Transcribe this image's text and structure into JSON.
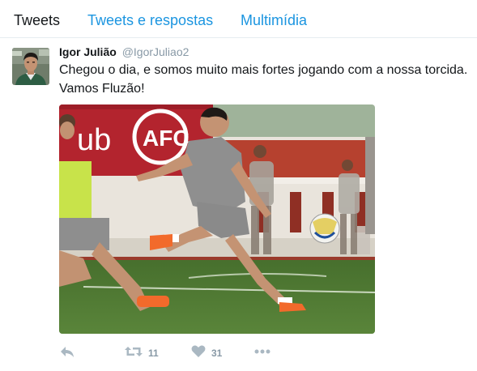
{
  "tabs": [
    {
      "label": "Tweets",
      "active": true
    },
    {
      "label": "Tweets e respostas",
      "active": false
    },
    {
      "label": "Multimídia",
      "active": false
    }
  ],
  "tweet": {
    "fullname": "Igor Julião",
    "username": "@IgorJuliao2",
    "text_line1": "Chegou o dia, e somos muito mais fortes jogando com a nossa torcida.",
    "text_line2": "Vamos Fluzão!",
    "media": {
      "banner_text": "ub",
      "crest_text": "AFC"
    },
    "actions": {
      "reply_icon": "reply-icon",
      "retweet_icon": "retweet-icon",
      "retweet_count": "11",
      "like_icon": "heart-icon",
      "like_count": "31",
      "more_icon": "more-icon"
    }
  },
  "colors": {
    "link_blue": "#1b95e0",
    "action_gray": "#aab8c2",
    "count_gray": "#8899a6",
    "border": "#e6ecf0"
  }
}
